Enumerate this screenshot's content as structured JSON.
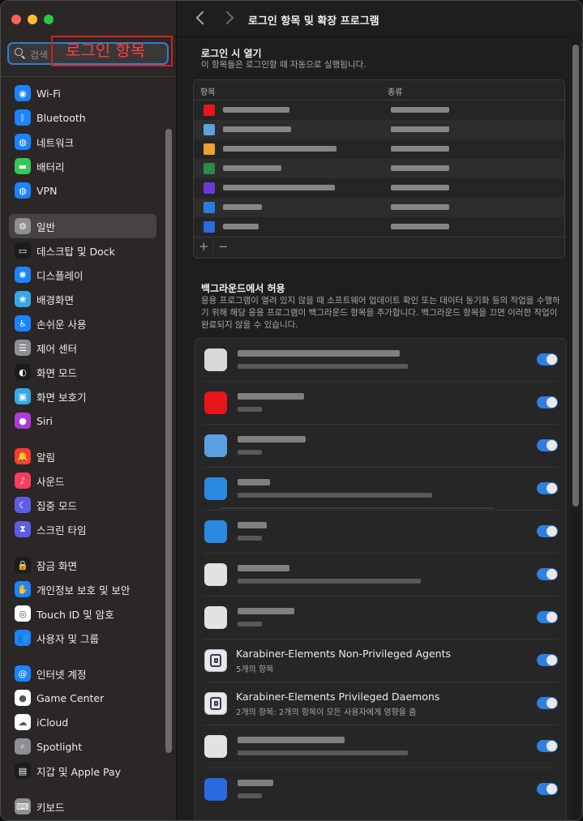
{
  "search": {
    "placeholder": "검색",
    "typed_value": "로그인 항목"
  },
  "sidebar": {
    "groups": [
      [
        {
          "label": "Wi-Fi",
          "icon": "wifi-icon",
          "color": "#1a84ff",
          "glyph": "◉"
        },
        {
          "label": "Bluetooth",
          "icon": "bluetooth-icon",
          "color": "#1a84ff",
          "glyph": "ᛒ"
        },
        {
          "label": "네트워크",
          "icon": "network-icon",
          "color": "#1a84ff",
          "glyph": "◍"
        },
        {
          "label": "배터리",
          "icon": "battery-icon",
          "color": "#34c759",
          "glyph": "▬"
        },
        {
          "label": "VPN",
          "icon": "vpn-icon",
          "color": "#1a84ff",
          "glyph": "◍"
        }
      ],
      [
        {
          "label": "일반",
          "icon": "gear-icon",
          "color": "#8e8e93",
          "glyph": "⚙",
          "selected": true
        },
        {
          "label": "데스크탑 및 Dock",
          "icon": "dock-icon",
          "color": "#1c1c1e",
          "glyph": "▭"
        },
        {
          "label": "디스플레이",
          "icon": "display-icon",
          "color": "#1a84ff",
          "glyph": "✺"
        },
        {
          "label": "배경화면",
          "icon": "wallpaper-icon",
          "color": "#36a8e8",
          "glyph": "❀"
        },
        {
          "label": "손쉬운 사용",
          "icon": "accessibility-icon",
          "color": "#1a84ff",
          "glyph": "♿"
        },
        {
          "label": "제어 센터",
          "icon": "control-center-icon",
          "color": "#8e8e93",
          "glyph": "☰"
        },
        {
          "label": "화면 모드",
          "icon": "appearance-icon",
          "color": "#1c1c1e",
          "glyph": "◐"
        },
        {
          "label": "화면 보호기",
          "icon": "screensaver-icon",
          "color": "#36a8e8",
          "glyph": "▣"
        },
        {
          "label": "Siri",
          "icon": "siri-icon",
          "color": "#b03ad8",
          "glyph": "●"
        }
      ],
      [
        {
          "label": "알림",
          "icon": "notifications-icon",
          "color": "#ff3b30",
          "glyph": "🔔"
        },
        {
          "label": "사운드",
          "icon": "sound-icon",
          "color": "#ff3b5c",
          "glyph": "♪"
        },
        {
          "label": "집중 모드",
          "icon": "focus-icon",
          "color": "#5e5ce6",
          "glyph": "☾"
        },
        {
          "label": "스크린 타임",
          "icon": "screen-time-icon",
          "color": "#5e5ce6",
          "glyph": "⧗"
        }
      ],
      [
        {
          "label": "잠금 화면",
          "icon": "lock-icon",
          "color": "#1c1c1e",
          "glyph": "🔒"
        },
        {
          "label": "개인정보 보호 및 보안",
          "icon": "privacy-hand-icon",
          "color": "#1a84ff",
          "glyph": "✋"
        },
        {
          "label": "Touch ID 및 암호",
          "icon": "fingerprint-icon",
          "color": "#ffffff",
          "glyph": "◎"
        },
        {
          "label": "사용자 및 그룹",
          "icon": "users-icon",
          "color": "#1a84ff",
          "glyph": "👥"
        }
      ],
      [
        {
          "label": "인터넷 계정",
          "icon": "at-icon",
          "color": "#1a84ff",
          "glyph": "@"
        },
        {
          "label": "Game Center",
          "icon": "game-center-icon",
          "color": "#ffffff",
          "glyph": "●"
        },
        {
          "label": "iCloud",
          "icon": "icloud-icon",
          "color": "#ffffff",
          "glyph": "☁"
        },
        {
          "label": "Spotlight",
          "icon": "spotlight-icon",
          "color": "#8e8e93",
          "glyph": "⌕"
        },
        {
          "label": "지갑 및 Apple Pay",
          "icon": "wallet-icon",
          "color": "#1c1c1e",
          "glyph": "▤"
        }
      ],
      [
        {
          "label": "키보드",
          "icon": "keyboard-icon",
          "color": "#8e8e93",
          "glyph": "⌨"
        }
      ]
    ]
  },
  "main": {
    "title": "로그인 항목 및 확장 프로그램",
    "login_section": {
      "title": "로그인 시 열기",
      "subtitle": "이 항목들은 로그인할 때 자동으로 실행됩니다.",
      "col_item": "항목",
      "col_kind": "종류",
      "add_label": "+",
      "remove_label": "−",
      "rows": [
        {
          "icon_color": "#e8151b",
          "name_w": 82
        },
        {
          "icon_color": "#5aa0e0",
          "name_w": 84
        },
        {
          "icon_color": "#f0a030",
          "name_w": 140
        },
        {
          "icon_color": "#2d8a4a",
          "name_w": 72
        },
        {
          "icon_color": "#6a3ad8",
          "name_w": 138
        },
        {
          "icon_color": "#2a7de0",
          "name_w": 48
        },
        {
          "icon_color": "#2a6ae0",
          "name_w": 44
        }
      ]
    },
    "background_section": {
      "title": "백그라운드에서 허용",
      "subtitle": "응용 프로그램이 열려 있지 않을 때 소프트웨어 업데이트 확인 또는 데이터 동기화 등의 작업을 수행하기 위해 해당 응용 프로그램이 백그라운드 항목을 추가합니다. 백그라운드 항목을 끄면 이러한 작업이 완료되지 않을 수 있습니다.",
      "items": [
        {
          "blur": true,
          "icon_color": "#d8d8d8",
          "w1": 200,
          "w2": 210,
          "enabled": true
        },
        {
          "blur": true,
          "icon_color": "#e8151b",
          "w1": 82,
          "w2": 30,
          "enabled": true
        },
        {
          "blur": true,
          "icon_color": "#5aa0e0",
          "w1": 84,
          "w2": 30,
          "enabled": true
        },
        {
          "blur": true,
          "icon_color": "#2a8ae0",
          "w1": 40,
          "w2": 240,
          "enabled": true
        },
        {
          "blur": true,
          "icon_color": "#2a8ae0",
          "w1": 36,
          "w2": 30,
          "enabled": true
        },
        {
          "blur": true,
          "icon_color": "#e2e2e2",
          "w1": 64,
          "w2": 226,
          "enabled": true
        },
        {
          "blur": true,
          "icon_color": "#e2e2e2",
          "w1": 70,
          "w2": 30,
          "enabled": true
        },
        {
          "blur": false,
          "name": "Karabiner-Elements Non-Privileged Agents",
          "desc": "5개의 항목",
          "enabled": true
        },
        {
          "blur": false,
          "name": "Karabiner-Elements Privileged Daemons",
          "desc": "2개의 항목: 2개의 항목이 모든 사용자에게 영향을 줌",
          "enabled": true
        },
        {
          "blur": true,
          "icon_color": "#e2e2e2",
          "w1": 132,
          "w2": 210,
          "enabled": true
        },
        {
          "blur": true,
          "icon_color": "#2a6ae0",
          "w1": 44,
          "w2": 30,
          "enabled": true
        }
      ]
    }
  }
}
